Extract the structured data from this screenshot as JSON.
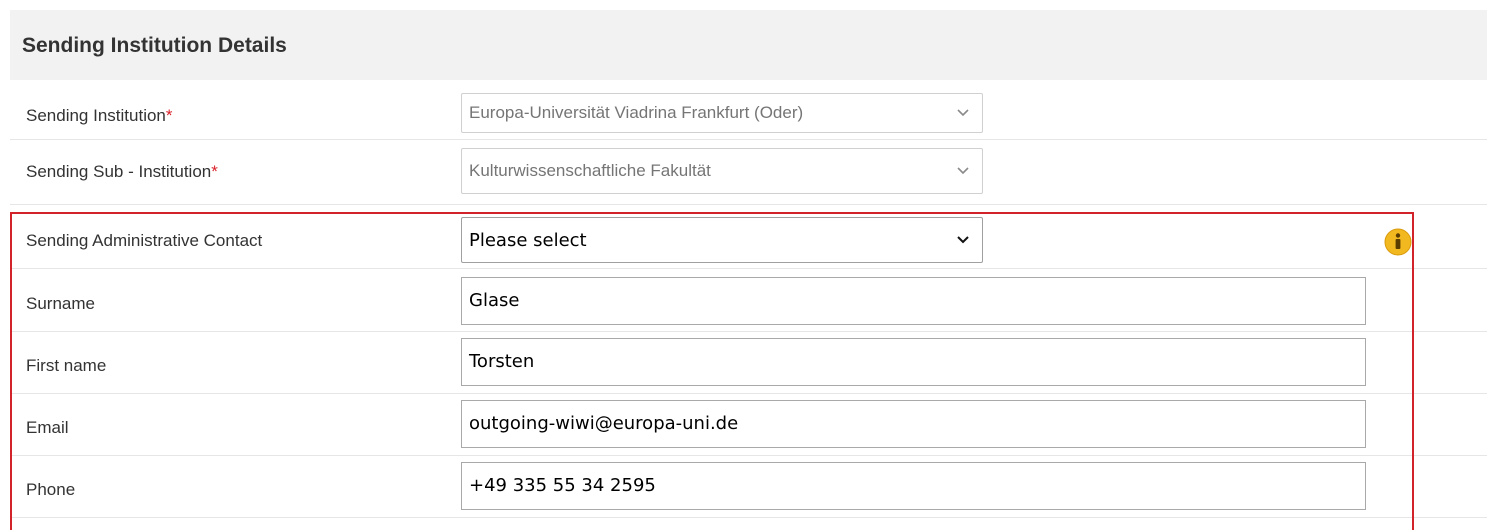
{
  "section": {
    "title": "Sending Institution Details"
  },
  "fields": {
    "sending_institution": {
      "label": "Sending Institution",
      "required_mark": "*",
      "value": "Europa-Universität Viadrina Frankfurt (Oder)"
    },
    "sending_sub_institution": {
      "label": "Sending Sub - Institution",
      "required_mark": "*",
      "value": "Kulturwissenschaftliche Fakultät"
    },
    "administrative_contact": {
      "label": "Sending Administrative Contact",
      "value": "Please select"
    },
    "surname": {
      "label": "Surname",
      "value": "Glase"
    },
    "first_name": {
      "label": "First name",
      "value": "Torsten"
    },
    "email": {
      "label": "Email",
      "value": "outgoing-wiwi@europa-uni.de"
    },
    "phone": {
      "label": "Phone",
      "value": "+49 335 55 34 2595"
    }
  },
  "icons": {
    "info": "info-icon",
    "dropdown": "chevron-down-icon"
  },
  "colors": {
    "required": "#d9222a",
    "highlight_border": "#d2232a",
    "info_icon": "#f2b81f",
    "header_bg": "#f2f2f2"
  }
}
